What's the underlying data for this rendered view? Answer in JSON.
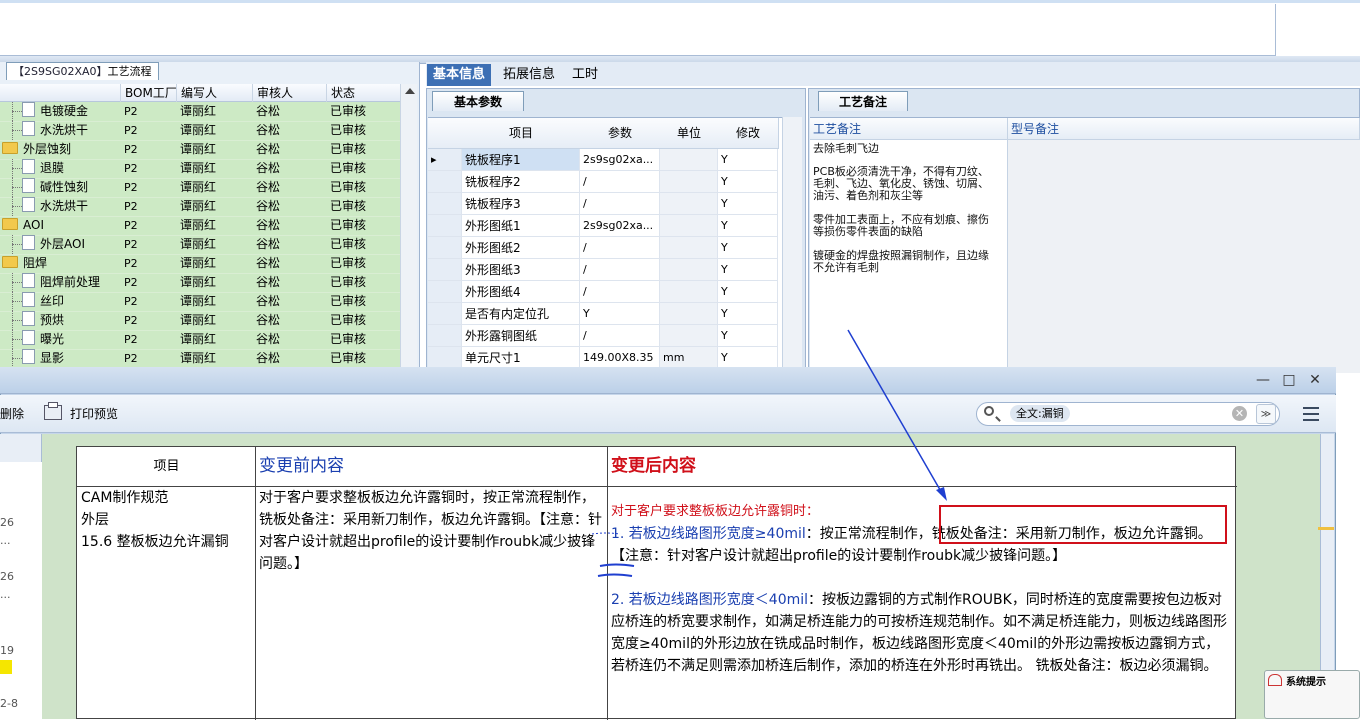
{
  "process_panel": {
    "tab_code": "【2S9SG02XA0】",
    "tab_title": "工艺流程",
    "columns": [
      "BOM工厂",
      "编写人",
      "审核人",
      "状态"
    ],
    "rows": [
      {
        "name": "电镀硬金",
        "kind": "item",
        "factory": "P2",
        "writer": "谭丽红",
        "reviewer": "谷松",
        "status": "已审核"
      },
      {
        "name": "水洗烘干",
        "kind": "item",
        "factory": "P2",
        "writer": "谭丽红",
        "reviewer": "谷松",
        "status": "已审核"
      },
      {
        "name": "外层蚀刻",
        "kind": "folder",
        "factory": "P2",
        "writer": "谭丽红",
        "reviewer": "谷松",
        "status": "已审核"
      },
      {
        "name": "退膜",
        "kind": "item",
        "factory": "P2",
        "writer": "谭丽红",
        "reviewer": "谷松",
        "status": "已审核"
      },
      {
        "name": "碱性蚀刻",
        "kind": "item",
        "factory": "P2",
        "writer": "谭丽红",
        "reviewer": "谷松",
        "status": "已审核"
      },
      {
        "name": "水洗烘干",
        "kind": "item",
        "factory": "P2",
        "writer": "谭丽红",
        "reviewer": "谷松",
        "status": "已审核"
      },
      {
        "name": "AOI",
        "kind": "folder",
        "factory": "P2",
        "writer": "谭丽红",
        "reviewer": "谷松",
        "status": "已审核"
      },
      {
        "name": "外层AOI",
        "kind": "item",
        "factory": "P2",
        "writer": "谭丽红",
        "reviewer": "谷松",
        "status": "已审核"
      },
      {
        "name": "阻焊",
        "kind": "folder",
        "factory": "P2",
        "writer": "谭丽红",
        "reviewer": "谷松",
        "status": "已审核"
      },
      {
        "name": "阻焊前处理",
        "kind": "item",
        "factory": "P2",
        "writer": "谭丽红",
        "reviewer": "谷松",
        "status": "已审核"
      },
      {
        "name": "丝印",
        "kind": "item",
        "factory": "P2",
        "writer": "谭丽红",
        "reviewer": "谷松",
        "status": "已审核"
      },
      {
        "name": "预烘",
        "kind": "item",
        "factory": "P2",
        "writer": "谭丽红",
        "reviewer": "谷松",
        "status": "已审核"
      },
      {
        "name": "曝光",
        "kind": "item",
        "factory": "P2",
        "writer": "谭丽红",
        "reviewer": "谷松",
        "status": "已审核"
      },
      {
        "name": "显影",
        "kind": "item",
        "factory": "P2",
        "writer": "谭丽红",
        "reviewer": "谷松",
        "status": "已审核"
      }
    ]
  },
  "tabs": {
    "basic": "基本信息",
    "extended": "拓展信息",
    "time": "工时"
  },
  "params_panel": {
    "tab": "基本参数",
    "columns": [
      "项目",
      "参数",
      "单位",
      "修改"
    ],
    "rows": [
      {
        "item": "铣板程序1",
        "param": "2s9sg02xa...",
        "unit": "",
        "modify": "Y"
      },
      {
        "item": "铣板程序2",
        "param": "/",
        "unit": "",
        "modify": "Y"
      },
      {
        "item": "铣板程序3",
        "param": "/",
        "unit": "",
        "modify": "Y"
      },
      {
        "item": "外形图纸1",
        "param": "2s9sg02xa...",
        "unit": "",
        "modify": "Y"
      },
      {
        "item": "外形图纸2",
        "param": "/",
        "unit": "",
        "modify": "Y"
      },
      {
        "item": "外形图纸3",
        "param": "/",
        "unit": "",
        "modify": "Y"
      },
      {
        "item": "外形图纸4",
        "param": "/",
        "unit": "",
        "modify": "Y"
      },
      {
        "item": "是否有内定位孔",
        "param": "Y",
        "unit": "",
        "modify": "Y"
      },
      {
        "item": "外形露铜图纸",
        "param": "/",
        "unit": "",
        "modify": "Y"
      },
      {
        "item": "单元尺寸1",
        "param": "149.00X8.35",
        "unit": "mm",
        "modify": "Y"
      }
    ]
  },
  "remarks_panel": {
    "tab": "工艺备注",
    "col_process": "工艺备注",
    "col_model": "型号备注",
    "lines": [
      "去除毛刺飞边",
      "PCB板必须清洗干净，不得有刀纹、毛刺、飞边、氧化皮、锈蚀、切屑、油污、着色剂和灰尘等",
      "零件加工表面上，不应有划痕、擦伤等损伤零件表面的缺陷",
      "镀硬金的焊盘按照漏铜制作，且边缘不允许有毛刺"
    ]
  },
  "doc_window": {
    "toolbar": {
      "delete": "删除",
      "print_preview": "打印预览"
    },
    "search": {
      "chip": "全文:漏铜"
    },
    "sidebar_numbers": [
      "26",
      "...",
      "26",
      "...",
      "19",
      "2-8"
    ],
    "table": {
      "header_item": "项目",
      "header_before": "变更前内容",
      "header_after": "变更后内容",
      "item_lines": [
        "CAM制作规范",
        "外层",
        "15.6 整板板边允许漏铜"
      ],
      "before_text": "对于客户要求整板板边允许露铜时，按正常流程制作，铣板处备注：采用新刀制作，板边允许露铜。【注意：针对客户设计就超出profile的设计要制作roubk减少披锋问题。】",
      "after_intro": "对于客户要求整板板边允许露铜时：",
      "after_p1_blue": "1. 若板边线路图形宽度≥40mil",
      "after_p1_rest": "：按正常流程制作，铣板处备注：采用新刀制作，板边允许露铜。【注意：针对客户设计就超出profile的设计要制作roubk减少披锋问题。】",
      "after_p2_blue": "2. 若板边线路图形宽度＜40mil",
      "after_p2_rest": "：按板边露铜的方式制作ROUBK，同时桥连的宽度需要按包边板对应桥连的桥宽要求制作，如满足桥连能力的可按桥连规范制作。如不满足桥连能力，则板边线路图形宽度≥40mil的外形边放在铣成品时制作，板边线路图形宽度＜40mil的外形边需按板边露铜方式，若桥连仍不满足则需添加桥连后制作，添加的桥连在外形时再铣出。 铣板处备注：板边必须漏铜。"
    }
  },
  "notification": {
    "title": "系统提示"
  },
  "colors": {
    "accent": "#3c6fb4",
    "green_rows": "#cdeac5",
    "red_heading": "#d0101a",
    "blue_text": "#1a3fb0"
  }
}
